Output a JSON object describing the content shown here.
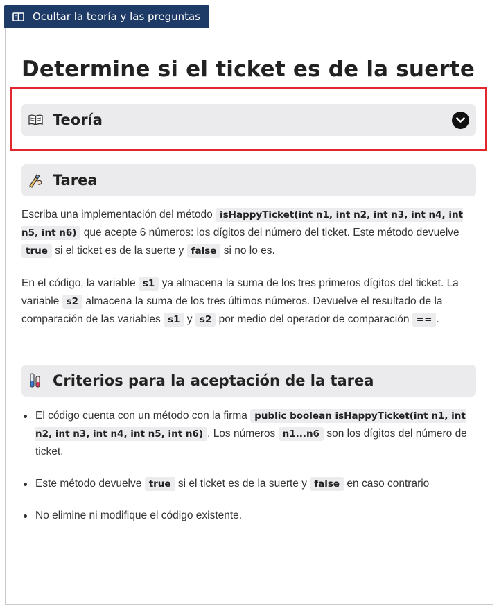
{
  "toolbar": {
    "hide_button_label": "Ocultar la teoría y las preguntas"
  },
  "page": {
    "title": "Determine si el ticket es de la suerte"
  },
  "theory": {
    "title": "Teoría"
  },
  "task": {
    "title": "Tarea",
    "p1": {
      "t1": "Escriba una implementación del método ",
      "code1": "isHappyTicket(int n1, int n2, int n3, int n4, int n5, int n6)",
      "t2": " que acepte 6 números: los dígitos del número del ticket. Este método devuelve ",
      "code2": "true",
      "t3": " si el ticket es de la suerte y ",
      "code3": "false",
      "t4": " si no lo es."
    },
    "p2": {
      "t1": "En el código, la variable ",
      "code1": "s1",
      "t2": " ya almacena la suma de los tres primeros dígitos del ticket. La variable ",
      "code2": "s2",
      "t3": " almacena la suma de los tres últimos números. Devuelve el resultado de la comparación de las variables ",
      "code3": "s1",
      "t4": " y ",
      "code4": "s2",
      "t5": " por medio del operador de comparación ",
      "code5": "==",
      "t6": "."
    }
  },
  "criteria": {
    "title": "Criterios para la aceptación de la tarea",
    "item1": {
      "t1": "El código cuenta con un método con la firma ",
      "code1": "public boolean isHappyTicket(int n1, int n2, int n3, int n4, int n5, int n6)",
      "t2": ". Los números ",
      "code2": "n1...n6",
      "t3": " son los dígitos del número de ticket."
    },
    "item2": {
      "t1": "Este método devuelve ",
      "code1": "true",
      "t2": " si el ticket es de la suerte y ",
      "code2": "false",
      "t3": " en caso contrario"
    },
    "item3": {
      "t1": "No elimine ni modifique el código existente."
    }
  },
  "colors": {
    "accent_button": "#1e3a66",
    "highlight_border": "#e2262e",
    "section_bg": "#ebebed"
  },
  "icons": {
    "toolbar": "book-panel-icon",
    "theory": "open-book-icon",
    "task": "pen-hand-icon",
    "criteria": "flask-icon",
    "toggle": "chevron-down-icon"
  }
}
